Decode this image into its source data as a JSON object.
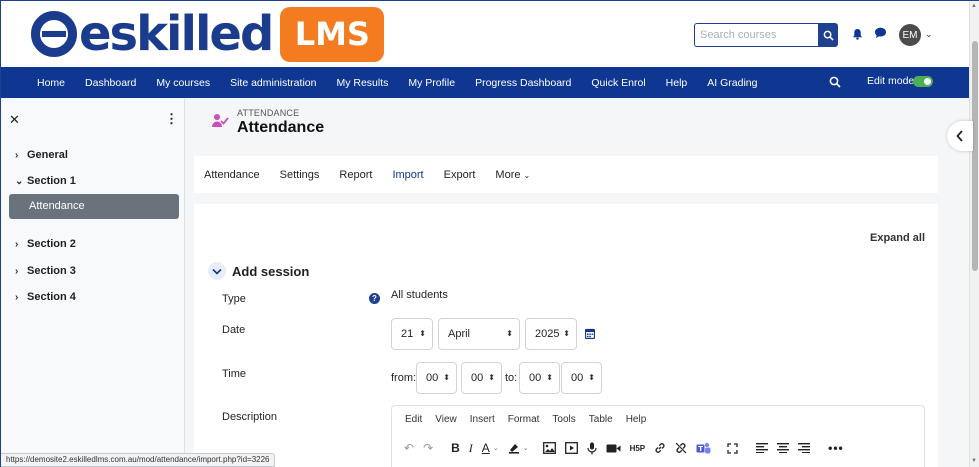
{
  "header": {
    "logo_text": "eskilled",
    "logo_badge": "LMS",
    "search_placeholder": "Search courses",
    "avatar_initials": "EM"
  },
  "nav": {
    "items": [
      "Home",
      "Dashboard",
      "My courses",
      "Site administration",
      "My Results",
      "My Profile",
      "Progress Dashboard",
      "Quick Enrol",
      "Help",
      "AI Grading"
    ],
    "edit_mode_label": "Edit mode",
    "edit_mode_on": true
  },
  "sidebar": {
    "sections": [
      "General",
      "Section 1",
      "Section 2",
      "Section 3",
      "Section 4"
    ],
    "active_item": "Attendance"
  },
  "page": {
    "kicker": "ATTENDANCE",
    "title": "Attendance"
  },
  "secondary_nav": {
    "items": [
      "Attendance",
      "Settings",
      "Report",
      "Import",
      "Export",
      "More"
    ],
    "active": "Import"
  },
  "form": {
    "expand_all": "Expand all",
    "section_title": "Add session",
    "type_label": "Type",
    "type_value": "All students",
    "date_label": "Date",
    "date_day": "21",
    "date_month": "April",
    "date_year": "2025",
    "time_label": "Time",
    "time_from_label": "from:",
    "time_to_label": "to:",
    "from_hour": "00",
    "from_min": "00",
    "to_hour": "00",
    "to_min": "00",
    "description_label": "Description"
  },
  "editor": {
    "menu": [
      "Edit",
      "View",
      "Insert",
      "Format",
      "Tools",
      "Table",
      "Help"
    ]
  },
  "statusbar": {
    "url": "https://demosite2.eskilledlms.com.au/mod/attendance/import.php?id=3226"
  },
  "colors": {
    "brand_blue": "#0f3792",
    "brand_orange": "#f47b20",
    "toggle_green": "#4caf50"
  }
}
